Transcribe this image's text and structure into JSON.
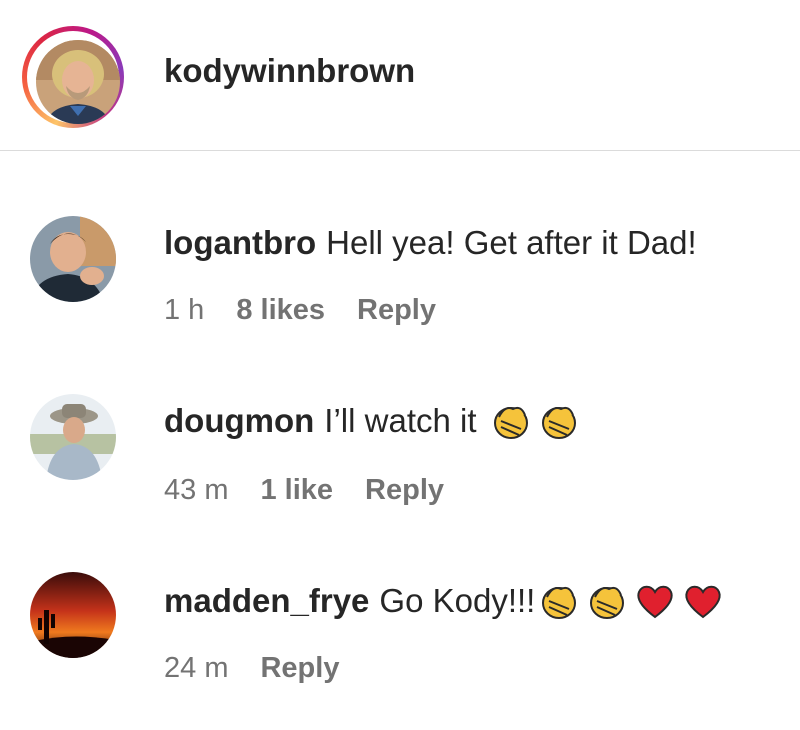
{
  "header": {
    "username": "kodywinnbrown",
    "ring_colors": [
      "#fdc468",
      "#dc2743",
      "#bc1888"
    ]
  },
  "comments": [
    {
      "username": "logantbro",
      "text": "Hell yea! Get after it Dad!",
      "time": "1 h",
      "likes": "8 likes",
      "reply": "Reply",
      "emojis": []
    },
    {
      "username": "dougmon",
      "text": "I’ll watch it",
      "time": "43 m",
      "likes": "1 like",
      "reply": "Reply",
      "emojis": [
        "clapping-hands-icon",
        "clapping-hands-icon"
      ]
    },
    {
      "username": "madden_frye",
      "text": "Go Kody!!!",
      "time": "24 m",
      "likes": "",
      "reply": "Reply",
      "emojis": [
        "clapping-hands-icon",
        "clapping-hands-icon",
        "red-heart-icon",
        "red-heart-icon"
      ]
    }
  ],
  "colors": {
    "text": "#262626",
    "meta": "#737373",
    "divider": "#dbdbdb",
    "heart": "#e0202e",
    "clap": "#f5c33b"
  }
}
